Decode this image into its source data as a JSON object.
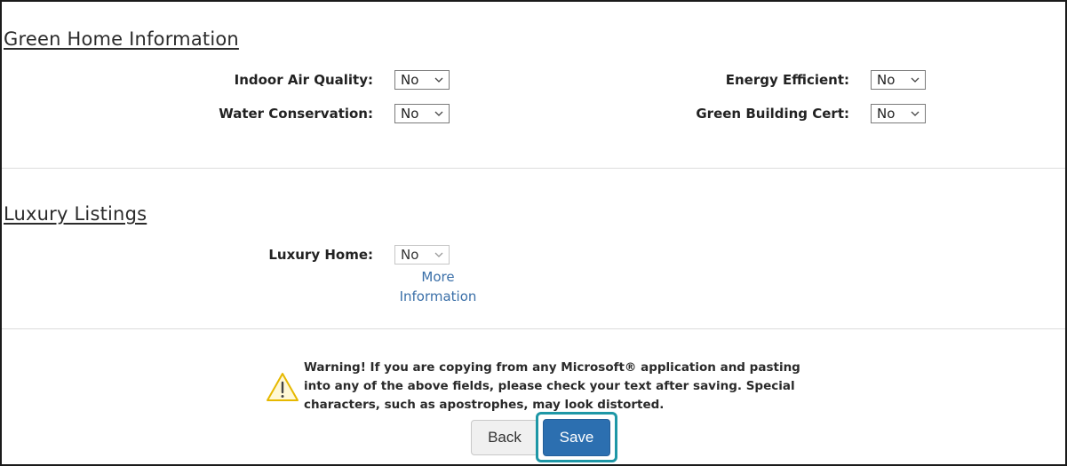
{
  "green": {
    "title": "Green Home Information",
    "fields": {
      "indoor_air": {
        "label": "Indoor Air Quality:",
        "value": "No"
      },
      "water": {
        "label": "Water Conservation:",
        "value": "No"
      },
      "energy": {
        "label": "Energy Efficient:",
        "value": "No"
      },
      "cert": {
        "label": "Green Building Cert:",
        "value": "No"
      }
    }
  },
  "luxury": {
    "title": "Luxury Listings",
    "home": {
      "label": "Luxury Home:",
      "value": "No"
    },
    "more_info": "More Information"
  },
  "warning": {
    "text": "Warning! If you are copying from any Microsoft® application and pasting into any of the above fields, please check your text after saving. Special characters, such as apostrophes, may look distorted."
  },
  "buttons": {
    "back": "Back",
    "save": "Save"
  },
  "colors": {
    "link": "#3a6fa8",
    "save_bg": "#2c6fb0",
    "focus_ring": "#1e97a6",
    "warning": "#e6b800"
  }
}
